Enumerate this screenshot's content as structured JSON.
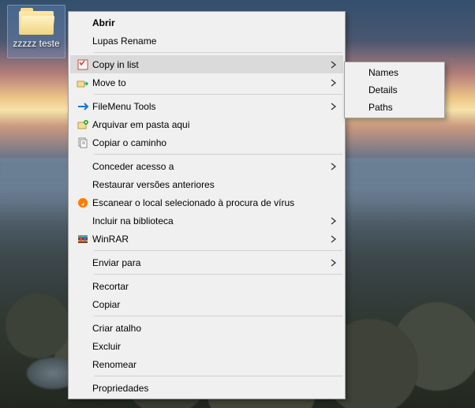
{
  "desktop": {
    "icon_label": "zzzzz teste"
  },
  "menu": {
    "items": [
      {
        "label": "Abrir",
        "bold": true
      },
      {
        "label": "Lupas Rename"
      },
      {
        "sep": true
      },
      {
        "label": "Copy in list",
        "icon": "copy-list",
        "sub": true,
        "highlight": true
      },
      {
        "label": "Move to",
        "icon": "move-to",
        "sub": true
      },
      {
        "sep": true
      },
      {
        "label": "FileMenu Tools",
        "icon": "filemenu",
        "sub": true
      },
      {
        "label": "Arquivar em pasta aqui",
        "icon": "archive"
      },
      {
        "label": "Copiar o caminho",
        "icon": "copy-path"
      },
      {
        "sep": true
      },
      {
        "label": "Conceder acesso a",
        "sub": true
      },
      {
        "label": "Restaurar versões anteriores"
      },
      {
        "label": "Escanear o local selecionado à procura de vírus",
        "icon": "avast"
      },
      {
        "label": "Incluir na biblioteca",
        "sub": true
      },
      {
        "label": "WinRAR",
        "icon": "winrar",
        "sub": true
      },
      {
        "sep": true
      },
      {
        "label": "Enviar para",
        "sub": true
      },
      {
        "sep": true
      },
      {
        "label": "Recortar"
      },
      {
        "label": "Copiar"
      },
      {
        "sep": true
      },
      {
        "label": "Criar atalho"
      },
      {
        "label": "Excluir"
      },
      {
        "label": "Renomear"
      },
      {
        "sep": true
      },
      {
        "label": "Propriedades"
      }
    ]
  },
  "submenu": {
    "items": [
      {
        "label": "Names"
      },
      {
        "label": "Details"
      },
      {
        "label": "Paths"
      }
    ]
  }
}
